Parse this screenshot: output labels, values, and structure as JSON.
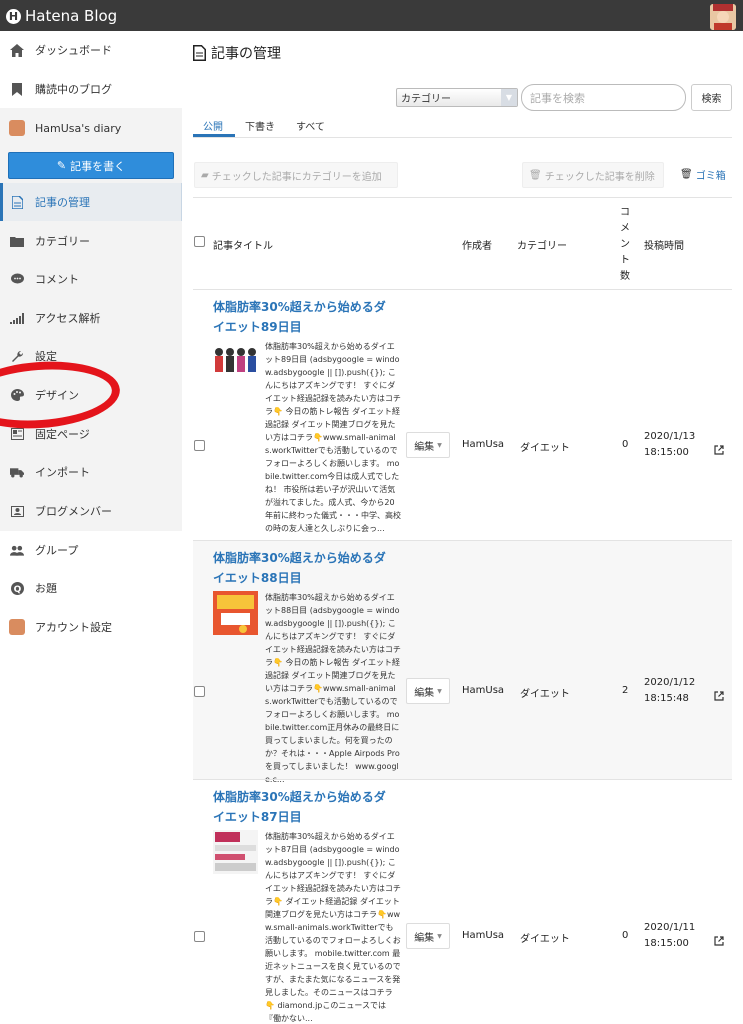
{
  "topbar": {
    "logo_text": "Hatena Blog",
    "logo_mark": "H"
  },
  "sidebar": {
    "items": [
      {
        "label": "ダッシュボード",
        "icon": "home-icon"
      },
      {
        "label": "購読中のブログ",
        "icon": "bookmark-icon"
      },
      {
        "label": "HamUsa's diary",
        "icon": "avatar"
      },
      {
        "label": "記事の管理",
        "icon": "document-icon"
      },
      {
        "label": "カテゴリー",
        "icon": "folder-icon"
      },
      {
        "label": "コメント",
        "icon": "comment-icon"
      },
      {
        "label": "アクセス解析",
        "icon": "bar-signal-icon"
      },
      {
        "label": "設定",
        "icon": "wrench-icon"
      },
      {
        "label": "デザイン",
        "icon": "palette-icon"
      },
      {
        "label": "固定ページ",
        "icon": "page-icon"
      },
      {
        "label": "インポート",
        "icon": "truck-icon"
      },
      {
        "label": "ブログメンバー",
        "icon": "member-icon"
      },
      {
        "label": "グループ",
        "icon": "group-icon"
      },
      {
        "label": "お題",
        "icon": "question-icon"
      },
      {
        "label": "アカウント設定",
        "icon": "avatar"
      }
    ],
    "write_button": "記事を書く"
  },
  "main": {
    "title": "記事の管理",
    "category_select": "カテゴリー",
    "search_placeholder": "記事を検索",
    "search_button": "検索",
    "tabs": [
      "公開",
      "下書き",
      "すべて"
    ],
    "bulk_add_category": "チェックした記事にカテゴリーを追加",
    "bulk_delete": "チェックした記事を削除",
    "trash": "ゴミ箱",
    "columns": {
      "title": "記事タイトル",
      "author": "作成者",
      "category": "カテゴリー",
      "comments": "コメント数",
      "posted": "投稿時間"
    },
    "edit_label": "編集",
    "posts": [
      {
        "title": "体脂肪率30%超えから始めるダイエット89日目",
        "excerpt": "体脂肪率30%超えから始めるダイエット89日目 (adsbygoogle = window.adsbygoogle || []).push({}); こんにちはアズキングです！ すぐにダイエット経過記録を読みたい方はコチラ👇 今日の筋トレ報告 ダイエット経過記録 ダイエット関連ブログを見たい方はコチラ👇www.small-animals.workTwitterでも活動しているのでフォローよろしくお願いします。 mobile.twitter.com今日は成人式でしたね！ 市役所は若い子が沢山いて活気が溢れてました。成人式、今から20年前に終わった儀式・・・中学、高校の時の友人達と久しぶりに会っ...",
        "author": "HamUsa",
        "category": "ダイエット",
        "comments": "0",
        "date": "2020/1/13",
        "time": "18:15:00"
      },
      {
        "title": "体脂肪率30%超えから始めるダイエット88日目",
        "excerpt": "体脂肪率30%超えから始めるダイエット88日目 (adsbygoogle = window.adsbygoogle || []).push({}); こんにちはアズキングです！ すぐにダイエット経過記録を読みたい方はコチラ👇 今日の筋トレ報告 ダイエット経過記録 ダイエット関連ブログを見たい方はコチラ👇www.small-animals.workTwitterでも活動しているのでフォローよろしくお願いします。 mobile.twitter.com正月休みの最終日に買ってしまいました。何を買ったのか？それは・・・Apple Airpods Proを買ってしまいました！ www.google.c...",
        "author": "HamUsa",
        "category": "ダイエット",
        "comments": "2",
        "date": "2020/1/12",
        "time": "18:15:48"
      },
      {
        "title": "体脂肪率30%超えから始めるダイエット87日目",
        "excerpt": "体脂肪率30%超えから始めるダイエット87日目 (adsbygoogle = window.adsbygoogle || []).push({}); こんにちはアズキングです！ すぐにダイエット経過記録を読みたい方はコチラ👇 ダイエット経過記録 ダイエット関連ブログを見たい方はコチラ👇www.small-animals.workTwitterでも活動しているのでフォローよろしくお願いします。 mobile.twitter.com 最近ネットニュースを良く見ているのですが、またまた気になるニュースを発見しました。そのニュースはコチラ👇 diamond.jpこのニュースでは『働かない...",
        "author": "HamUsa",
        "category": "ダイエット",
        "comments": "0",
        "date": "2020/1/11",
        "time": "18:15:00"
      }
    ]
  },
  "colors": {
    "accent": "#2a74b7",
    "write_button": "#2f8ddb",
    "annotation": "#e4141b"
  }
}
